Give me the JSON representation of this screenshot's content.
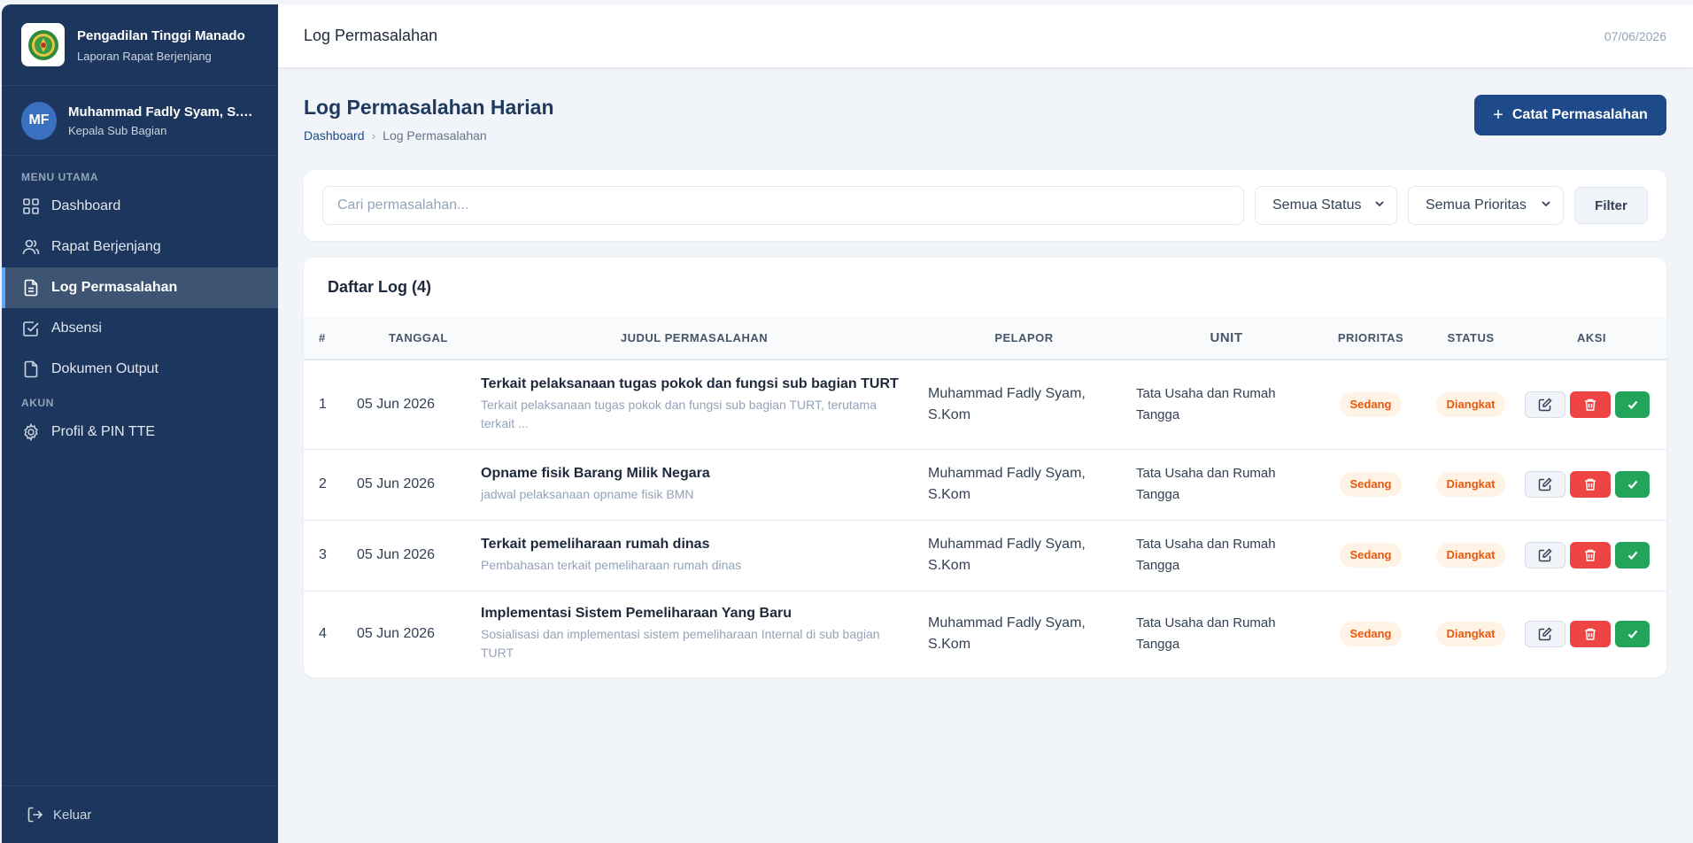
{
  "sidebar": {
    "brand_title": "Pengadilan Tinggi Manado",
    "brand_subtitle": "Laporan Rapat Berjenjang",
    "user_initials": "MF",
    "user_name": "Muhammad Fadly Syam, S.Kom",
    "user_role": "Kepala Sub Bagian",
    "section_main": "MENU UTAMA",
    "section_account": "AKUN",
    "items": [
      {
        "label": "Dashboard",
        "icon": "grid-icon"
      },
      {
        "label": "Rapat Berjenjang",
        "icon": "users-icon"
      },
      {
        "label": "Log Permasalahan",
        "icon": "file-text-icon",
        "active": true
      },
      {
        "label": "Absensi",
        "icon": "check-square-icon"
      },
      {
        "label": "Dokumen Output",
        "icon": "file-icon"
      }
    ],
    "account_items": [
      {
        "label": "Profil & PIN TTE",
        "icon": "gear-icon"
      }
    ],
    "logout_label": "Keluar"
  },
  "topbar": {
    "title": "Log Permasalahan",
    "date": "07/06/2026"
  },
  "page": {
    "title": "Log Permasalahan Harian",
    "breadcrumb_home": "Dashboard",
    "breadcrumb_current": "Log Permasalahan",
    "add_button": "Catat Permasalahan"
  },
  "filters": {
    "search_placeholder": "Cari permasalahan...",
    "status_selected": "Semua Status",
    "priority_selected": "Semua Prioritas",
    "filter_button": "Filter"
  },
  "table": {
    "title": "Daftar Log (4)",
    "columns": [
      "#",
      "TANGGAL",
      "JUDUL PERMASALAHAN",
      "PELAPOR",
      "UNIT",
      "PRIORITAS",
      "STATUS",
      "AKSI"
    ],
    "rows": [
      {
        "no": "1",
        "date": "05 Jun 2026",
        "title": "Terkait pelaksanaan tugas pokok dan fungsi sub bagian TURT",
        "desc": "Terkait pelaksanaan tugas pokok dan fungsi sub bagian TURT, terutama terkait ...",
        "reporter": "Muhammad Fadly Syam, S.Kom",
        "unit": "Tata Usaha dan Rumah Tangga",
        "priority": "Sedang",
        "status": "Diangkat"
      },
      {
        "no": "2",
        "date": "05 Jun 2026",
        "title": "Opname fisik Barang Milik Negara",
        "desc": "jadwal pelaksanaan opname fisik BMN",
        "reporter": "Muhammad Fadly Syam, S.Kom",
        "unit": "Tata Usaha dan Rumah Tangga",
        "priority": "Sedang",
        "status": "Diangkat"
      },
      {
        "no": "3",
        "date": "05 Jun 2026",
        "title": "Terkait pemeliharaan rumah dinas",
        "desc": "Pembahasan terkait pemeliharaan rumah dinas",
        "reporter": "Muhammad Fadly Syam, S.Kom",
        "unit": "Tata Usaha dan Rumah Tangga",
        "priority": "Sedang",
        "status": "Diangkat"
      },
      {
        "no": "4",
        "date": "05 Jun 2026",
        "title": "Implementasi Sistem Pemeliharaan Yang Baru",
        "desc": "Sosialisasi dan implementasi sistem pemeliharaan Internal di sub bagian TURT",
        "reporter": "Muhammad Fadly Syam, S.Kom",
        "unit": "Tata Usaha dan Rumah Tangga",
        "priority": "Sedang",
        "status": "Diangkat"
      }
    ]
  },
  "colors": {
    "sidebar_bg": "#1c365d",
    "primary": "#1e4a8a",
    "danger": "#ef4444",
    "success": "#22a55a",
    "badge_text": "#ea580c"
  }
}
